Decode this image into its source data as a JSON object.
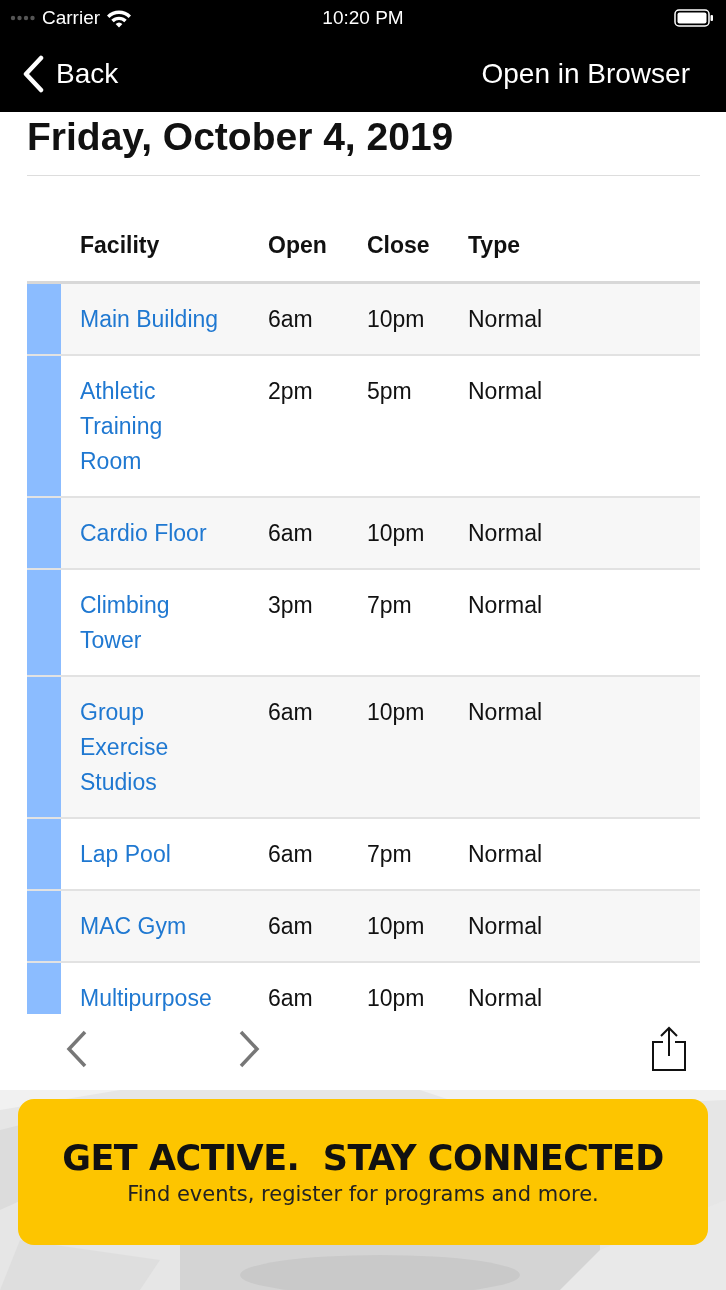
{
  "status_bar": {
    "carrier": "Carrier",
    "time": "10:20 PM"
  },
  "nav_bar": {
    "back": "Back",
    "action": "Open in Browser"
  },
  "title": "Friday, October 4, 2019",
  "table": {
    "columns": [
      "Facility",
      "Open",
      "Close",
      "Type"
    ],
    "rows": [
      {
        "facility": "Main Building",
        "open": "6am",
        "close": "10pm",
        "type": "Normal"
      },
      {
        "facility": "Athletic Training Room",
        "open": "2pm",
        "close": "5pm",
        "type": "Normal"
      },
      {
        "facility": "Cardio Floor",
        "open": "6am",
        "close": "10pm",
        "type": "Normal"
      },
      {
        "facility": "Climbing Tower",
        "open": "3pm",
        "close": "7pm",
        "type": "Normal"
      },
      {
        "facility": "Group Exercise Studios",
        "open": "6am",
        "close": "10pm",
        "type": "Normal"
      },
      {
        "facility": "Lap Pool",
        "open": "6am",
        "close": "7pm",
        "type": "Normal"
      },
      {
        "facility": "MAC Gym",
        "open": "6am",
        "close": "10pm",
        "type": "Normal"
      },
      {
        "facility": "Multipurpose",
        "open": "6am",
        "close": "10pm",
        "type": "Normal"
      }
    ]
  },
  "banner": {
    "heading": "GET ACTIVE.  STAY CONNECTED",
    "subtitle": "Find events, register for programs and more."
  }
}
